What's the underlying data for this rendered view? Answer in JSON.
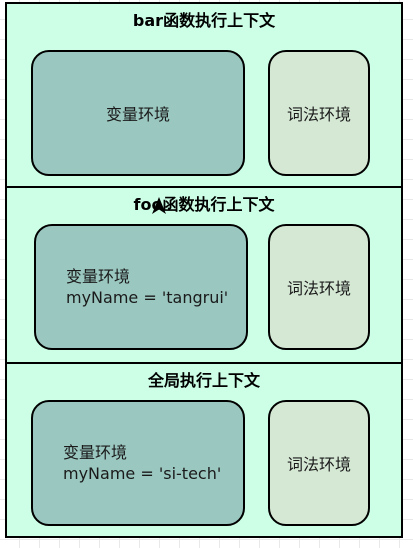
{
  "contexts": [
    {
      "title": "bar函数执行上下文",
      "variable_env": {
        "label": "变量环境"
      },
      "lexical_env": {
        "label": "词法环境"
      }
    },
    {
      "title": "foo函数执行上下文",
      "variable_env": {
        "label": "变量环境",
        "binding": "myName = 'tangrui'"
      },
      "lexical_env": {
        "label": "词法环境"
      }
    },
    {
      "title": "全局执行上下文",
      "variable_env": {
        "label": "变量环境",
        "binding": "myName = 'si-tech'"
      },
      "lexical_env": {
        "label": "词法环境"
      }
    }
  ],
  "colors": {
    "frame_fill": "#ccffe6",
    "variable_env_fill": "#9ac7bf",
    "lexical_env_fill": "#d5e8d4",
    "stroke": "#000000"
  },
  "icons": [
    "mouse-cursor-icon"
  ]
}
